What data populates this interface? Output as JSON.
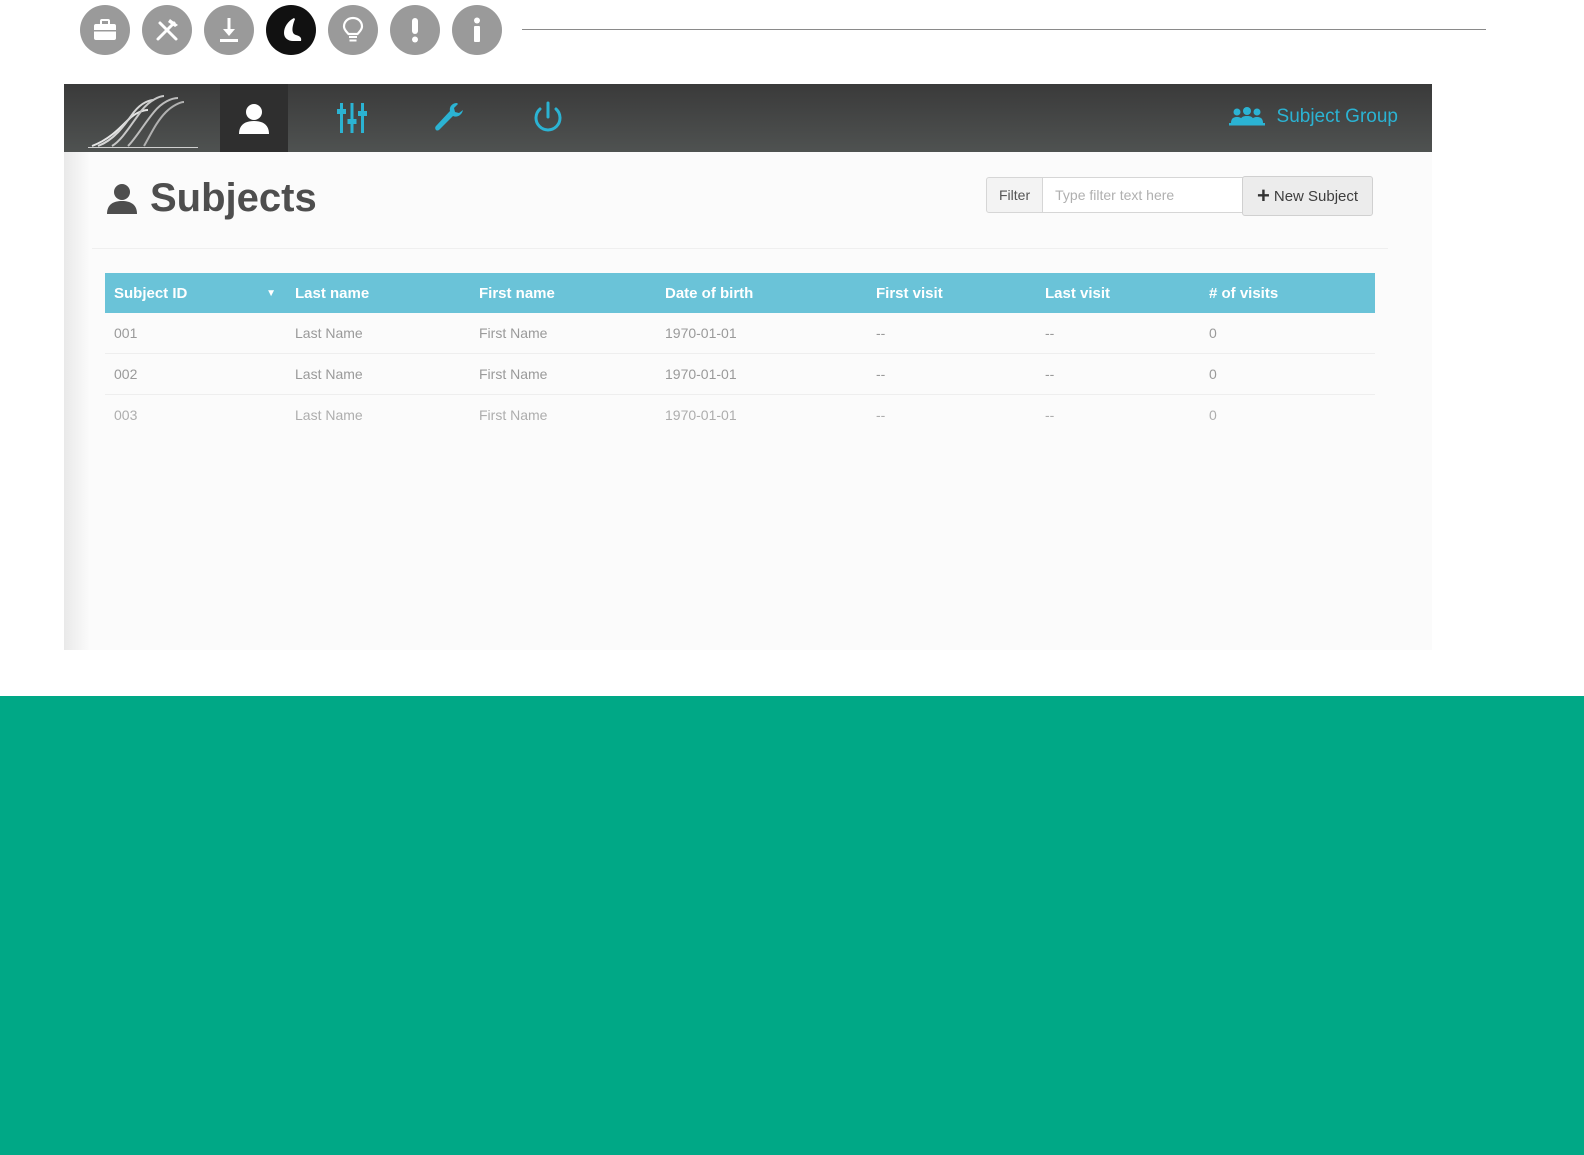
{
  "manual_icons": [
    {
      "icon": "briefcase-icon",
      "active": false
    },
    {
      "icon": "tools-icon",
      "active": false
    },
    {
      "icon": "install-icon",
      "active": false
    },
    {
      "icon": "foot-icon",
      "active": true
    },
    {
      "icon": "lightbulb-icon",
      "active": false
    },
    {
      "icon": "warning-icon",
      "active": false
    },
    {
      "icon": "info-icon",
      "active": false
    }
  ],
  "navbar": {
    "items": [
      "user-icon",
      "sliders-icon",
      "wrench-icon",
      "power-icon"
    ],
    "active_item": "user-icon",
    "group_label": "Subject Group",
    "accent": "#2bb3d3"
  },
  "header": {
    "title": "Subjects",
    "filter_label": "Filter",
    "filter_placeholder": "Type filter text here",
    "new_button_label": "New Subject"
  },
  "table": {
    "columns": [
      "Subject ID",
      "Last name",
      "First name",
      "Date of birth",
      "First visit",
      "Last visit",
      "# of visits"
    ],
    "rows": [
      [
        "001",
        "Last Name",
        "First Name",
        "1970-01-01",
        "--",
        "--",
        "0"
      ],
      [
        "002",
        "Last Name",
        "First Name",
        "1970-01-01",
        "--",
        "--",
        "0"
      ],
      [
        "003",
        "Last Name",
        "First Name",
        "1970-01-01",
        "--",
        "--",
        "0"
      ]
    ],
    "header_color": "#6ac3d8"
  },
  "band_color": "#00a886"
}
